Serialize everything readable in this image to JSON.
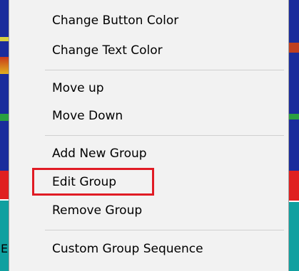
{
  "menu": {
    "items": [
      {
        "label": "Change Button Color"
      },
      {
        "label": "Change Text Color"
      },
      {
        "label": "Move up"
      },
      {
        "label": "Move Down"
      },
      {
        "label": "Add New Group"
      },
      {
        "label": "Edit Group"
      },
      {
        "label": "Remove Group"
      },
      {
        "label": "Custom Group Sequence"
      }
    ],
    "highlighted_item": "Edit Group",
    "highlight_color": "#e01b24",
    "background_color": "#f2f2f2"
  },
  "background": {
    "visible_letter": "E"
  }
}
